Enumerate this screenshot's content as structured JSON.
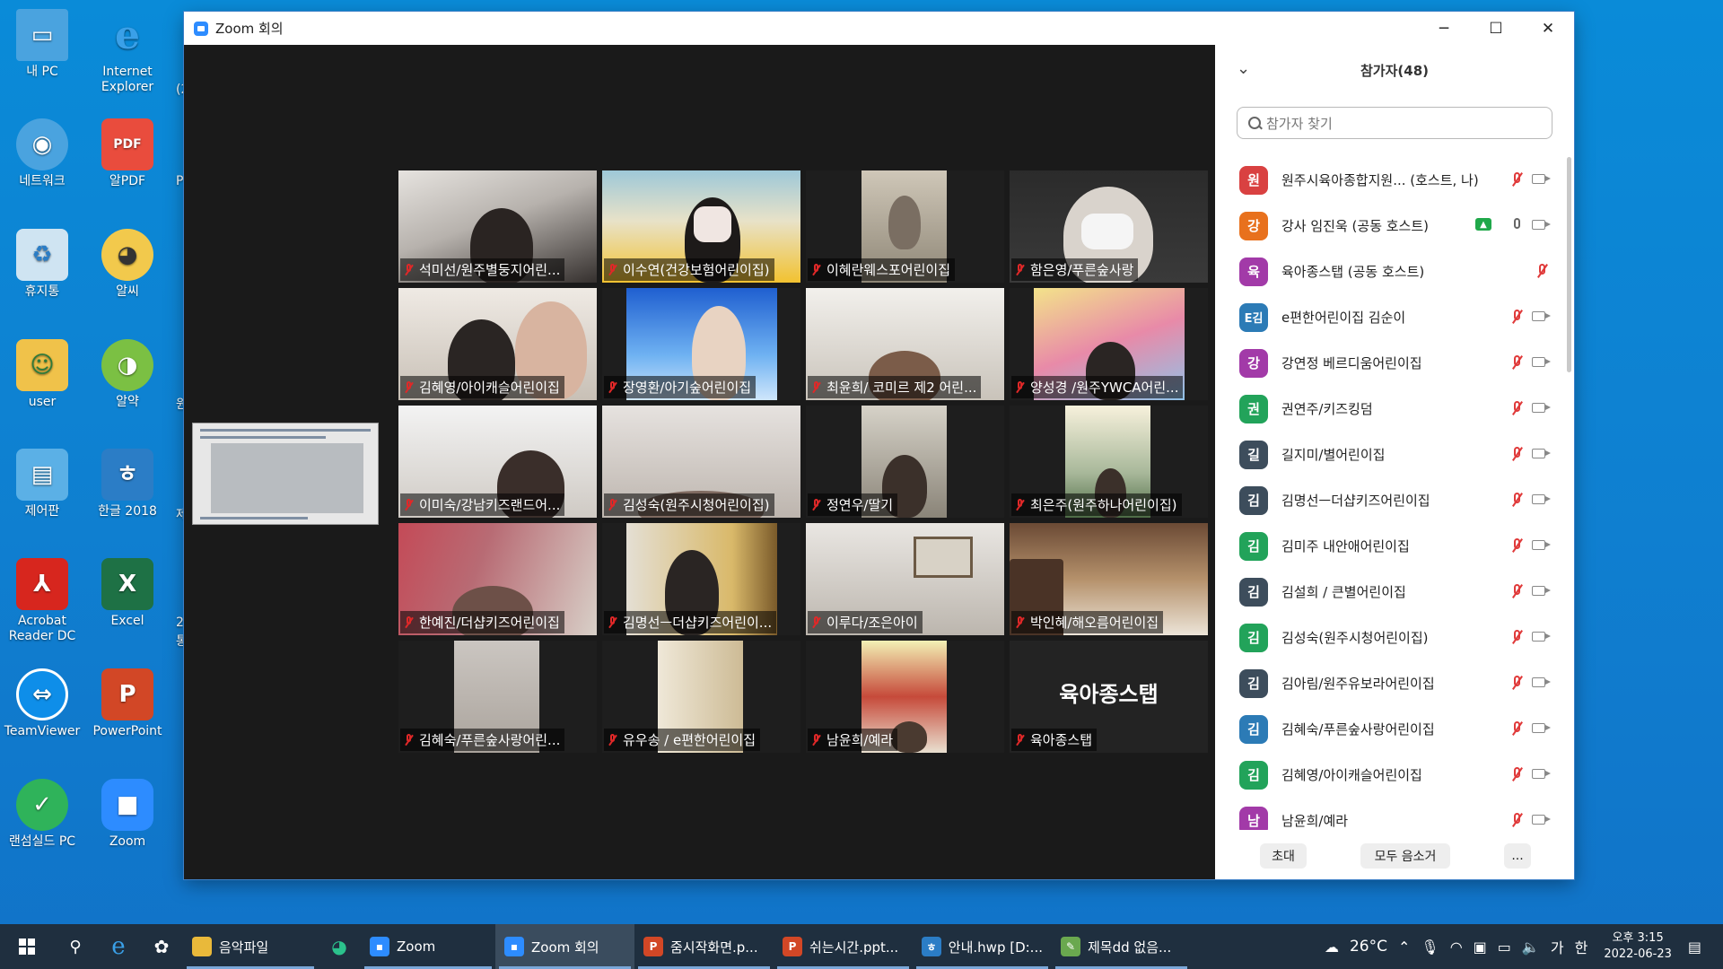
{
  "desktop": {
    "icons": [
      {
        "label": "내 PC",
        "icon": "pc-icon"
      },
      {
        "label": "Internet Explorer",
        "icon": "internet-explorer-icon"
      },
      {
        "label": "네트워크",
        "icon": "network-icon"
      },
      {
        "label": "알PDF",
        "icon": "alpdf-icon"
      },
      {
        "label": "휴지통",
        "icon": "recycle-bin-icon"
      },
      {
        "label": "알씨",
        "icon": "alsee-icon"
      },
      {
        "label": "user",
        "icon": "user-folder-icon"
      },
      {
        "label": "알약",
        "icon": "alyac-icon"
      },
      {
        "label": "제어판",
        "icon": "control-panel-icon"
      },
      {
        "label": "한글 2018",
        "icon": "hangul-icon"
      },
      {
        "label": "Acrobat Reader DC",
        "icon": "acrobat-icon"
      },
      {
        "label": "Excel",
        "icon": "excel-icon"
      },
      {
        "label": "TeamViewer",
        "icon": "teamviewer-icon"
      },
      {
        "label": "PowerPoint",
        "icon": "powerpoint-icon"
      },
      {
        "label": "랜섬실드 PC",
        "icon": "ransomshield-icon"
      },
      {
        "label": "Zoom",
        "icon": "zoom-icon"
      }
    ],
    "partial_labels": [
      "(2",
      "PS",
      "원",
      "제",
      "2",
      "통"
    ]
  },
  "window": {
    "title": "Zoom 회의",
    "controls": {
      "minimize": "─",
      "maximize": "☐",
      "close": "✕"
    }
  },
  "gallery": {
    "tiles": [
      {
        "name": "석미선/원주별둥지어린..."
      },
      {
        "name": "이수연(건강보험어린이집)"
      },
      {
        "name": "이혜란웨스포어린이집"
      },
      {
        "name": "함은영/푸른숲사랑"
      },
      {
        "name": "김혜영/아이캐슬어린이집"
      },
      {
        "name": "장영환/아기숲어린이집"
      },
      {
        "name": "최윤희/ 코미르 제2 어린..."
      },
      {
        "name": "양성경 /원주YWCA어린..."
      },
      {
        "name": "이미숙/강남키즈랜드어..."
      },
      {
        "name": "김성숙(원주시청어린이집)"
      },
      {
        "name": "정연우/딸기"
      },
      {
        "name": "최은주(원주하나어린이집)"
      },
      {
        "name": "한예진/더샵키즈어린이집"
      },
      {
        "name": "김명선ㅡ더샵키즈어린이..."
      },
      {
        "name": "이루다/조은아이"
      },
      {
        "name": "박인혜/해오름어린이집"
      },
      {
        "name": "김혜숙/푸른숲사랑어린..."
      },
      {
        "name": "유우송 / e편한어린이집"
      },
      {
        "name": "남윤희/예라"
      },
      {
        "name": "육아종스탭",
        "no_video_label": "육아종스탭"
      }
    ]
  },
  "participants_panel": {
    "title": "참가자(48)",
    "search_placeholder": "참가자 찾기",
    "items": [
      {
        "initial": "원",
        "name": "원주시육아종합지원... (호스트, 나)",
        "color": "#d94141",
        "mic": "muted",
        "video": "off"
      },
      {
        "initial": "강",
        "name": "강사 임진욱 (공동 호스트)",
        "color": "#e8711d",
        "mic": "on",
        "video": "off",
        "sharing": true
      },
      {
        "initial": "육",
        "name": "육아종스탭 (공동 호스트)",
        "color": "#a23aa8",
        "mic": "muted",
        "video": "none"
      },
      {
        "initial": "E김",
        "name": "e편한어린이집 김순이",
        "color": "#2c7bb6",
        "mic": "muted",
        "video": "off"
      },
      {
        "initial": "강",
        "name": "강연정 베르디움어린이집",
        "color": "#a23aa8",
        "mic": "muted",
        "video": "off"
      },
      {
        "initial": "권",
        "name": "권연주/키즈킹덤",
        "color": "#22a35a",
        "mic": "muted",
        "video": "off"
      },
      {
        "initial": "길",
        "name": "길지미/별어린이집",
        "color": "#3d4d5c",
        "mic": "muted",
        "video": "off"
      },
      {
        "initial": "김",
        "name": "김명선ㅡ더샵키즈어린이집",
        "color": "#3d4d5c",
        "mic": "muted",
        "video": "off"
      },
      {
        "initial": "김",
        "name": "김미주 내안애어린이집",
        "color": "#22a35a",
        "mic": "muted",
        "video": "off"
      },
      {
        "initial": "김",
        "name": "김설희 / 큰별어린이집",
        "color": "#3d4d5c",
        "mic": "muted",
        "video": "off"
      },
      {
        "initial": "김",
        "name": "김성숙(원주시청어린이집)",
        "color": "#22a35a",
        "mic": "muted",
        "video": "off"
      },
      {
        "initial": "김",
        "name": "김아림/원주유보라어린이집",
        "color": "#3d4d5c",
        "mic": "muted",
        "video": "off"
      },
      {
        "initial": "김",
        "name": "김혜숙/푸른숲사랑어린이집",
        "color": "#2c7bb6",
        "mic": "muted",
        "video": "off"
      },
      {
        "initial": "김",
        "name": "김혜영/아이캐슬어린이집",
        "color": "#22a35a",
        "mic": "muted",
        "video": "off"
      },
      {
        "initial": "남",
        "name": "남윤희/예라",
        "color": "#a23aa8",
        "mic": "muted",
        "video": "off"
      }
    ],
    "footer": {
      "invite": "초대",
      "mute_all": "모두 음소거",
      "more": "..."
    }
  },
  "taskbar": {
    "items": [
      {
        "label": "음악파일",
        "icon": "folder-icon",
        "color": "#e9b93a"
      },
      {
        "label": "Zoom",
        "icon": "zoom-icon",
        "color": "#2d8cff"
      },
      {
        "label": "Zoom 회의",
        "icon": "zoom-meeting-icon",
        "color": "#2d8cff"
      },
      {
        "label": "줌시작화면.p...",
        "icon": "powerpoint-icon",
        "color": "#d24726"
      },
      {
        "label": "쉬는시간.ppt...",
        "icon": "powerpoint-icon",
        "color": "#d24726"
      },
      {
        "label": "안내.hwp [D:...",
        "icon": "hangul-icon",
        "color": "#2b7dc6"
      },
      {
        "label": "제목dd 없음...",
        "icon": "paint-icon",
        "color": "#6aa84f"
      }
    ],
    "weather": "26°C",
    "ime": "가",
    "ime2": "한",
    "time": "오후 3:15",
    "date": "2022-06-23"
  }
}
